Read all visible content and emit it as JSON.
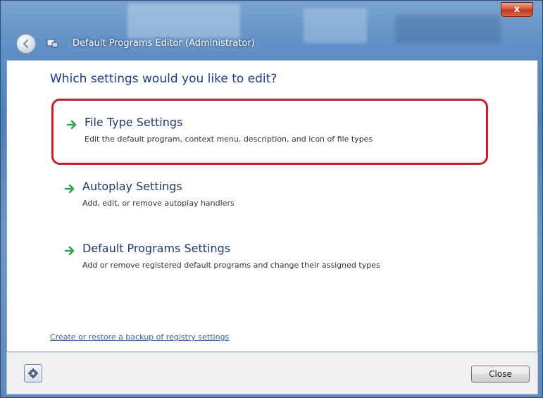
{
  "window": {
    "title": "Default Programs Editor (Administrator)",
    "close_glyph": "x"
  },
  "page": {
    "heading": "Which settings would you like to edit?"
  },
  "options": [
    {
      "title": "File Type Settings",
      "description": "Edit the default program, context menu, description, and icon of file types",
      "highlighted": true
    },
    {
      "title": "Autoplay Settings",
      "description": "Add, edit, or remove autoplay handlers",
      "highlighted": false
    },
    {
      "title": "Default Programs Settings",
      "description": "Add or remove registered default programs and change their assigned types",
      "highlighted": false
    }
  ],
  "footer": {
    "backup_link": "Create or restore a backup of registry settings",
    "close_label": "Close"
  },
  "icons": {
    "back": "back-arrow-icon",
    "app": "app-icon",
    "option_arrow": "green-arrow-icon",
    "settings": "gear-icon"
  },
  "colors": {
    "heading": "#1e3a8a",
    "highlight_border": "#c81e2b",
    "arrow_green": "#2ea44f",
    "link": "#2d5ea8"
  }
}
